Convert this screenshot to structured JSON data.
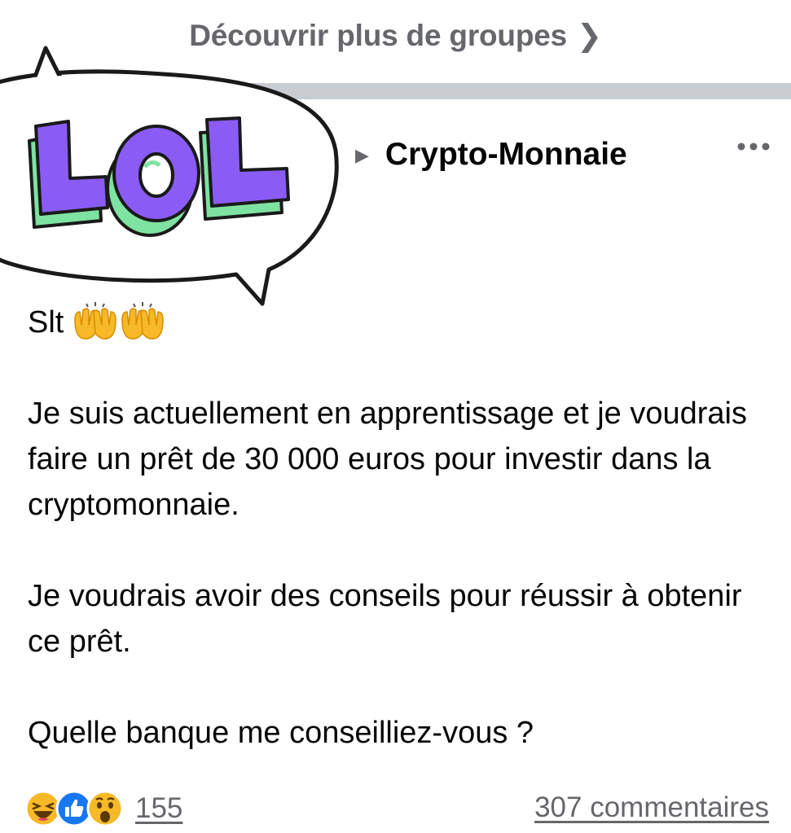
{
  "discover": {
    "label": "Découvrir plus de groupes",
    "chevron_icon": "chevron-right-icon"
  },
  "sticker": {
    "text": "LOL",
    "colors": {
      "letters": "#8a5cf5",
      "shadow": "#7ee2a0",
      "outline": "#1a1a1a"
    }
  },
  "group": {
    "arrow_icon": "triangle-right-icon",
    "name": "Crypto-Monnaie",
    "more_icon": "more-horizontal-icon"
  },
  "post": {
    "greeting": "Slt",
    "greeting_emoji": "raising-hands-emoji",
    "paragraphs": [
      "Je suis actuellement en apprentissage et je voudrais faire un prêt de 30 000 euros pour investir dans la cryptomonnaie.",
      "Je voudrais avoir des conseils pour réussir à obtenir ce prêt.",
      "Quelle banque me conseilliez-vous ?"
    ]
  },
  "footer": {
    "reaction_icons": [
      "haha-reaction-icon",
      "like-reaction-icon",
      "wow-reaction-icon"
    ],
    "reaction_count": "155",
    "comments": "307 commentaires"
  },
  "colors": {
    "secondary_text": "#65676b",
    "separator": "#c9ccd1",
    "like_blue": "#1877f2",
    "emoji_yellow": "#f7b928"
  }
}
